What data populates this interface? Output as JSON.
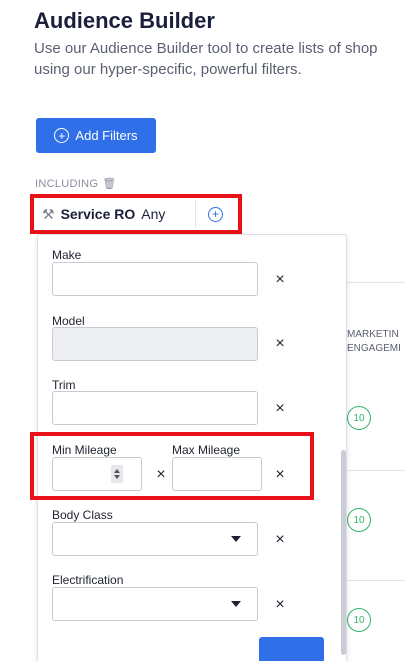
{
  "header": {
    "title": "Audience Builder",
    "subtitle": "Use our Audience Builder tool to create lists of shop using our hyper-specific, powerful filters."
  },
  "toolbar": {
    "add_filters_label": "Add Filters"
  },
  "including": {
    "label": "INCLUDING"
  },
  "chip": {
    "name": "Service RO",
    "value": "Any"
  },
  "filters": {
    "make_label": "Make",
    "model_label": "Model",
    "trim_label": "Trim",
    "min_mileage_label": "Min Mileage",
    "max_mileage_label": "Max Mileage",
    "body_class_label": "Body Class",
    "electrification_label": "Electrification",
    "remove_glyph": "×"
  },
  "background": {
    "column_header_line1": "MARKETIN",
    "column_header_line2": "ENGAGEMI",
    "badges": [
      "10",
      "10",
      "10"
    ]
  },
  "colors": {
    "accent": "#2f6fe8",
    "highlight": "#e8111a",
    "badge": "#34b36b"
  }
}
